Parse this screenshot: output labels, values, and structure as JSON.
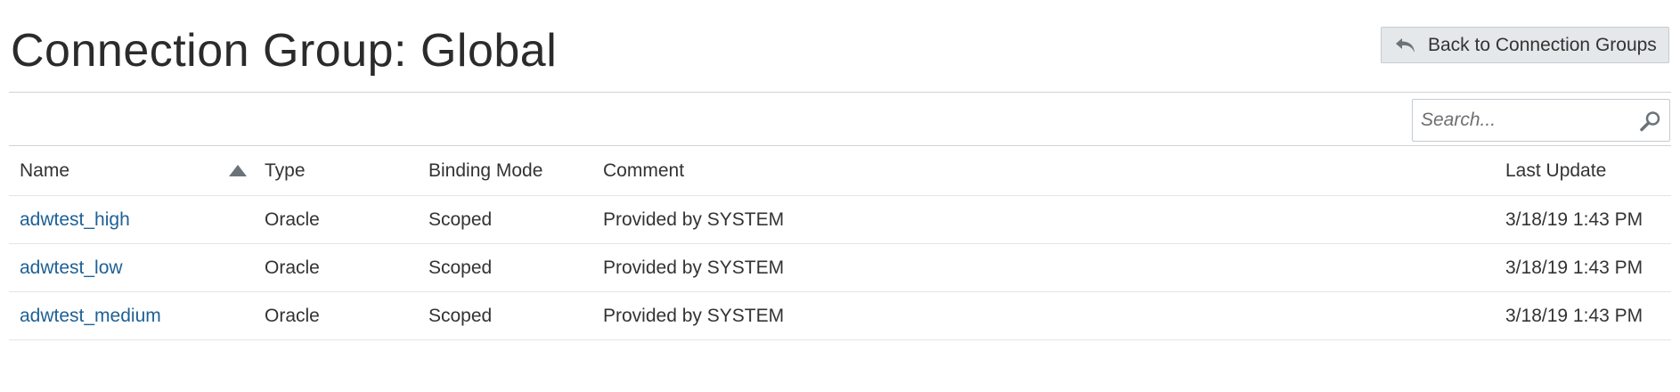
{
  "header": {
    "title": "Connection Group: Global",
    "back_button_label": "Back to Connection Groups",
    "back_icon": "undo-arrow-icon"
  },
  "search": {
    "placeholder": "Search...",
    "value": "",
    "icon": "magnifier-icon"
  },
  "table": {
    "columns": [
      "Name",
      "Type",
      "Binding Mode",
      "Comment",
      "Last Update"
    ],
    "sort": {
      "column": "Name",
      "direction": "ascending"
    },
    "rows": [
      {
        "name": "adwtest_high",
        "type": "Oracle",
        "binding_mode": "Scoped",
        "comment": "Provided by SYSTEM",
        "last_update": "3/18/19 1:43 PM"
      },
      {
        "name": "adwtest_low",
        "type": "Oracle",
        "binding_mode": "Scoped",
        "comment": "Provided by SYSTEM",
        "last_update": "3/18/19 1:43 PM"
      },
      {
        "name": "adwtest_medium",
        "type": "Oracle",
        "binding_mode": "Scoped",
        "comment": "Provided by SYSTEM",
        "last_update": "3/18/19 1:43 PM"
      }
    ]
  },
  "colors": {
    "link": "#1e6196",
    "button_bg": "#e4e8ea",
    "border": "#c4cbd1",
    "text": "#333333"
  }
}
